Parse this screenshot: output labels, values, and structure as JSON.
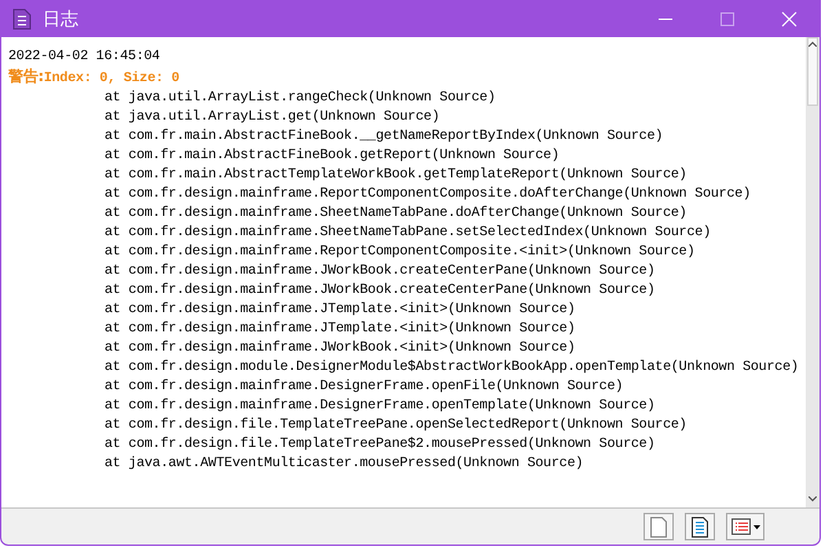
{
  "window": {
    "title": "日志"
  },
  "log": {
    "timestamp": "2022-04-02 16:45:04",
    "warning_label": "警告:",
    "warning_message": "Index: 0, Size: 0",
    "lines": [
      "at java.util.ArrayList.rangeCheck(Unknown Source)",
      "at java.util.ArrayList.get(Unknown Source)",
      "at com.fr.main.AbstractFineBook.__getNameReportByIndex(Unknown Source)",
      "at com.fr.main.AbstractFineBook.getReport(Unknown Source)",
      "at com.fr.main.AbstractTemplateWorkBook.getTemplateReport(Unknown Source)",
      "at com.fr.design.mainframe.ReportComponentComposite.doAfterChange(Unknown Source)",
      "at com.fr.design.mainframe.SheetNameTabPane.doAfterChange(Unknown Source)",
      "at com.fr.design.mainframe.SheetNameTabPane.setSelectedIndex(Unknown Source)",
      "at com.fr.design.mainframe.ReportComponentComposite.<init>(Unknown Source)",
      "at com.fr.design.mainframe.JWorkBook.createCenterPane(Unknown Source)",
      "at com.fr.design.mainframe.JWorkBook.createCenterPane(Unknown Source)",
      "at com.fr.design.mainframe.JTemplate.<init>(Unknown Source)",
      "at com.fr.design.mainframe.JTemplate.<init>(Unknown Source)",
      "at com.fr.design.mainframe.JWorkBook.<init>(Unknown Source)",
      "at com.fr.design.module.DesignerModule$AbstractWorkBookApp.openTemplate(Unknown Source)",
      "at com.fr.design.mainframe.DesignerFrame.openFile(Unknown Source)",
      "at com.fr.design.mainframe.DesignerFrame.openTemplate(Unknown Source)",
      "at com.fr.design.file.TemplateTreePane.openSelectedReport(Unknown Source)",
      "at com.fr.design.file.TemplateTreePane$2.mousePressed(Unknown Source)",
      "at java.awt.AWTEventMulticaster.mousePressed(Unknown Source)"
    ]
  }
}
